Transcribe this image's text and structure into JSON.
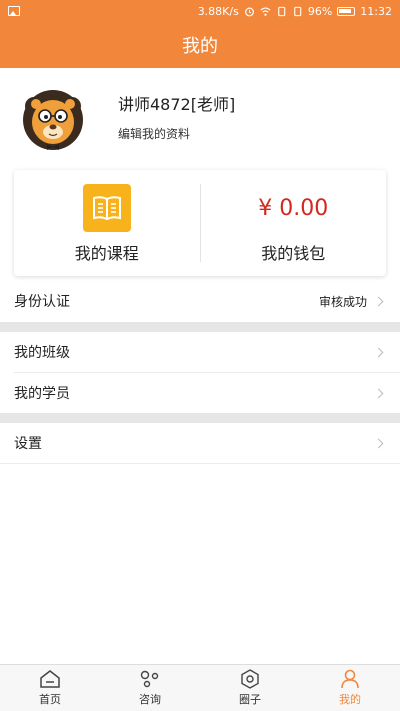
{
  "status_bar": {
    "network_speed": "3.88K/s",
    "battery": "96%",
    "time": "11:32"
  },
  "header": {
    "title": "我的"
  },
  "profile": {
    "name": "讲师4872[老师]",
    "edit_link": "编辑我的资料"
  },
  "card": {
    "courses_label": "我的课程",
    "wallet_amount": "¥ 0.00",
    "wallet_label": "我的钱包"
  },
  "menu": {
    "identity_label": "身份认证",
    "identity_status": "审核成功",
    "class_label": "我的班级",
    "students_label": "我的学员",
    "settings_label": "设置"
  },
  "bottom_nav": {
    "items": [
      {
        "label": "首页",
        "icon": "home-icon"
      },
      {
        "label": "咨询",
        "icon": "consult-icon"
      },
      {
        "label": "圈子",
        "icon": "circle-icon"
      },
      {
        "label": "我的",
        "icon": "profile-icon",
        "active": true
      }
    ]
  },
  "colors": {
    "accent": "#f2873c",
    "price": "#d2281f",
    "course_icon_bg": "#f7b21c",
    "section_gap": "#e6e6e6"
  }
}
